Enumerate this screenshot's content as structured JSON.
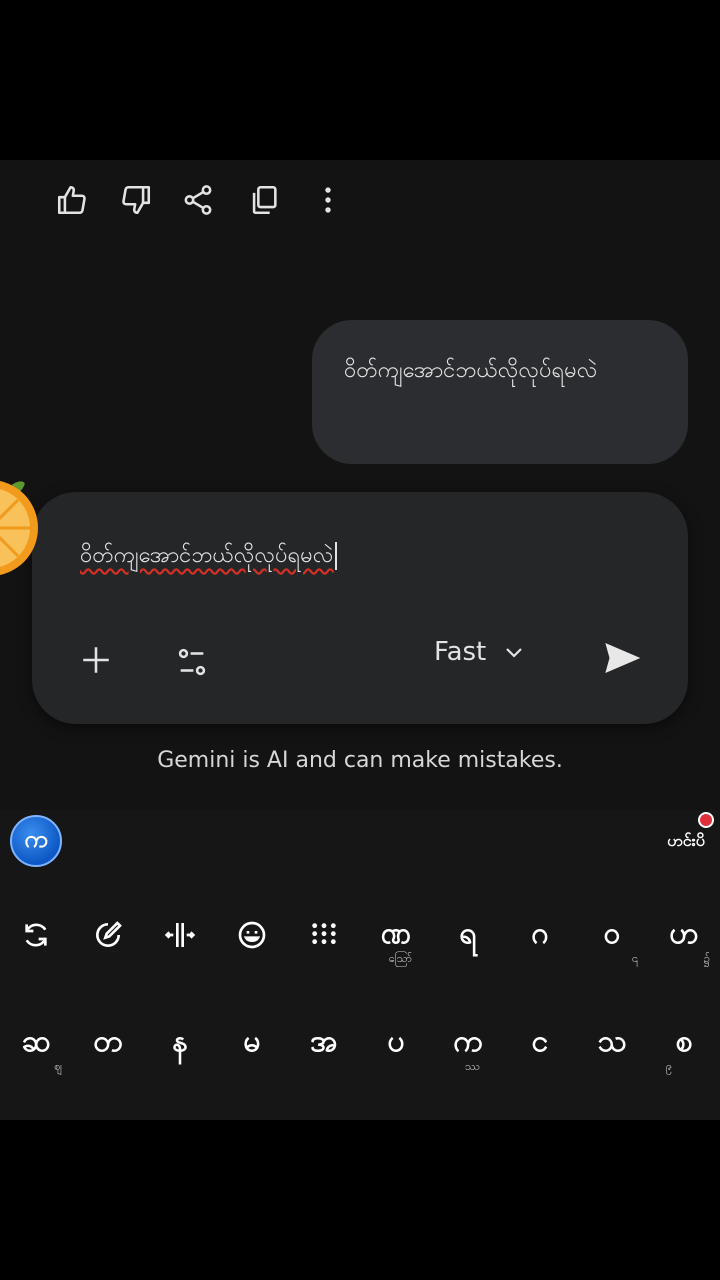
{
  "user_message": "ဝိတ်ကျအောင်ဘယ်လိုလုပ်ရမလဲ",
  "composer": {
    "input_value": "ဝိတ်ကျအောင်ဘယ်လိုလုပ်ရမလဲ",
    "model_label": "Fast"
  },
  "disclaimer": "Gemini is AI and can make mistakes.",
  "keyboard": {
    "logo_letter": "က",
    "brand_label": "ဟင်းပိ",
    "row1": [
      {
        "main": "ဏ",
        "sub": "ဪ"
      },
      {
        "main": "ရ",
        "sub": ""
      },
      {
        "main": "ဂ",
        "sub": ""
      },
      {
        "main": "ဝ",
        "sub": "၎"
      },
      {
        "main": "ဟ",
        "sub": "၌"
      }
    ],
    "row2": [
      {
        "main": "ဆ",
        "sub": "ဈ"
      },
      {
        "main": "တ",
        "sub": ""
      },
      {
        "main": "န",
        "sub": ""
      },
      {
        "main": "မ",
        "sub": ""
      },
      {
        "main": "အ",
        "sub": ""
      },
      {
        "main": "ပ",
        "sub": ""
      },
      {
        "main": "က",
        "sub": "ဿ"
      },
      {
        "main": "င",
        "sub": ""
      },
      {
        "main": "သ",
        "sub": ""
      },
      {
        "main": "စ",
        "sub": "၉"
      }
    ]
  },
  "icons": {
    "like": "thumbs-up-icon",
    "dislike": "thumbs-down-icon",
    "share": "share-icon",
    "copy": "copy-icon",
    "more": "more-vert-icon",
    "add": "plus-icon",
    "tools": "tune-icon",
    "send": "send-icon"
  }
}
